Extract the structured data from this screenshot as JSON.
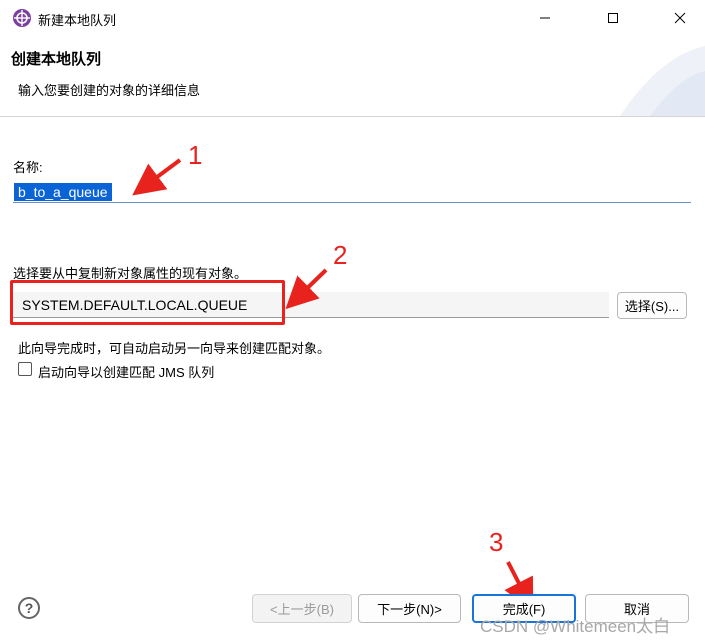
{
  "window": {
    "title": "新建本地队列",
    "min_glyph": "—",
    "max_glyph": "☐",
    "close_glyph": "✕"
  },
  "header": {
    "title": "创建本地队列",
    "description": "输入您要创建的对象的详细信息"
  },
  "form": {
    "name_label": "名称:",
    "name_value": "b_to_a_queue",
    "copy_label": "选择要从中复制新对象属性的现有对象。",
    "copy_value": "SYSTEM.DEFAULT.LOCAL.QUEUE",
    "select_button": "选择(S)...",
    "info_text": "此向导完成时，可自动启动另一向导来创建匹配对象。",
    "jms_checkbox_label": "启动向导以创建匹配 JMS 队列",
    "jms_checked": false
  },
  "annotations": {
    "n1": "1",
    "n2": "2",
    "n3": "3",
    "color": "#e8231e"
  },
  "footer": {
    "help": "?",
    "back": "<上一步(B)",
    "next": "下一步(N)>",
    "finish": "完成(F)",
    "cancel": "取消"
  },
  "watermark": "CSDN @Whitemeen太白",
  "colors": {
    "selection": "#0a64d6",
    "focus": "#1a73d9"
  }
}
